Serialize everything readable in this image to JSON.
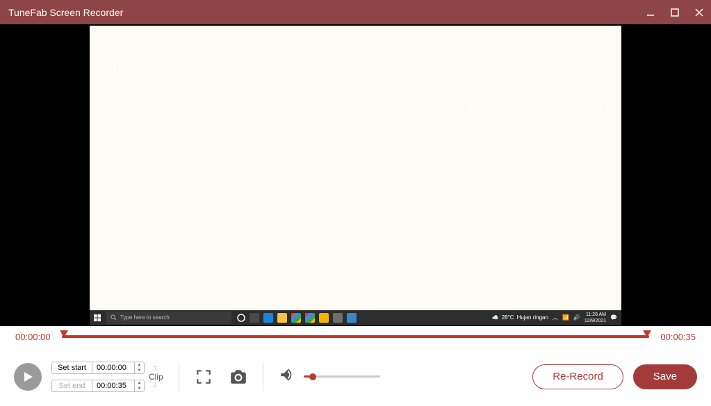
{
  "app_title": "TuneFab Screen Recorder",
  "recorded_desktop": {
    "search_placeholder": "Type here to search",
    "weather_temp": "28°C",
    "weather_desc": "Hujan ringan",
    "clock_time": "11:28 AM",
    "clock_date": "12/9/2021"
  },
  "timeline": {
    "start": "00:00:00",
    "end": "00:00:35"
  },
  "clip": {
    "set_start_label": "Set start",
    "set_start_time": "00:00:00",
    "set_end_label": "Set end",
    "set_end_time": "00:00:35",
    "clip_label": "Clip"
  },
  "volume_percent": 12,
  "actions": {
    "rerecord": "Re-Record",
    "save": "Save"
  }
}
